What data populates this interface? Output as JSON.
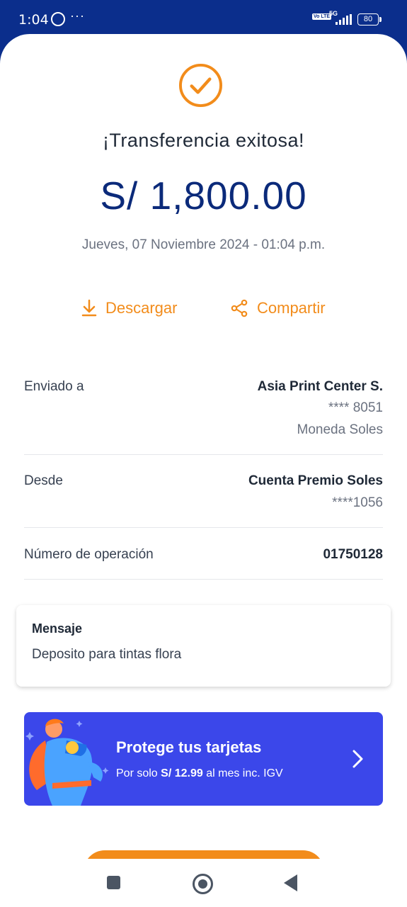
{
  "status_bar": {
    "time": "1:04",
    "dots": "···",
    "volte": "Vo LTE",
    "network": "5G",
    "battery": "80"
  },
  "receipt": {
    "title": "¡Transferencia exitosa!",
    "amount": "S/ 1,800.00",
    "date": "Jueves, 07 Noviembre 2024 - 01:04 p.m.",
    "actions": {
      "download": "Descargar",
      "share": "Compartir"
    },
    "sent_to": {
      "label": "Enviado a",
      "name": "Asia Print Center S.",
      "account": "**** 8051",
      "currency": "Moneda Soles"
    },
    "from": {
      "label": "Desde",
      "account_name": "Cuenta Premio Soles",
      "account": "****1056"
    },
    "operation": {
      "label": "Número de operación",
      "number": "01750128"
    },
    "message": {
      "title": "Mensaje",
      "body": "Deposito para tintas flora"
    }
  },
  "promo": {
    "title": "Protege tus tarjetas",
    "sub_prefix": "Por solo",
    "price": "S/ 12.99",
    "sub_suffix": "al mes inc. IGV"
  },
  "colors": {
    "brand_blue": "#0b2e8c",
    "accent_orange": "#f28c1b",
    "promo_blue": "#3b47ea"
  }
}
